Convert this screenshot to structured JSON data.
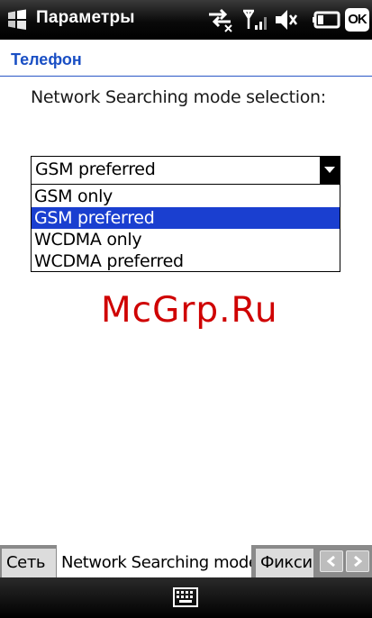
{
  "titlebar": {
    "start_icon": "windows-flag-icon",
    "title": "Параметры",
    "status_icons": [
      "connectivity-arrows-icon",
      "signal-strength-icon",
      "speaker-muted-icon",
      "battery-icon"
    ],
    "ok_label": "OK"
  },
  "page": {
    "title": "Телефон",
    "prompt": "Network Searching mode selection:"
  },
  "combo": {
    "value": "GSM preferred",
    "options": [
      "GSM only",
      "GSM preferred",
      "WCDMA only",
      "WCDMA preferred"
    ],
    "selected_index": 1
  },
  "watermark": "McGrp.Ru",
  "tabs": {
    "items": [
      "Сеть",
      "Network Searching mode",
      "Фиксир"
    ],
    "active_index": 1,
    "prev_icon": "chevron-left-icon",
    "next_icon": "chevron-right-icon"
  },
  "bottombar": {
    "keyboard_icon": "keyboard-icon"
  },
  "colors": {
    "accent": "#1a4fc4",
    "selection": "#1a3fd0",
    "watermark": "#cf0000"
  }
}
